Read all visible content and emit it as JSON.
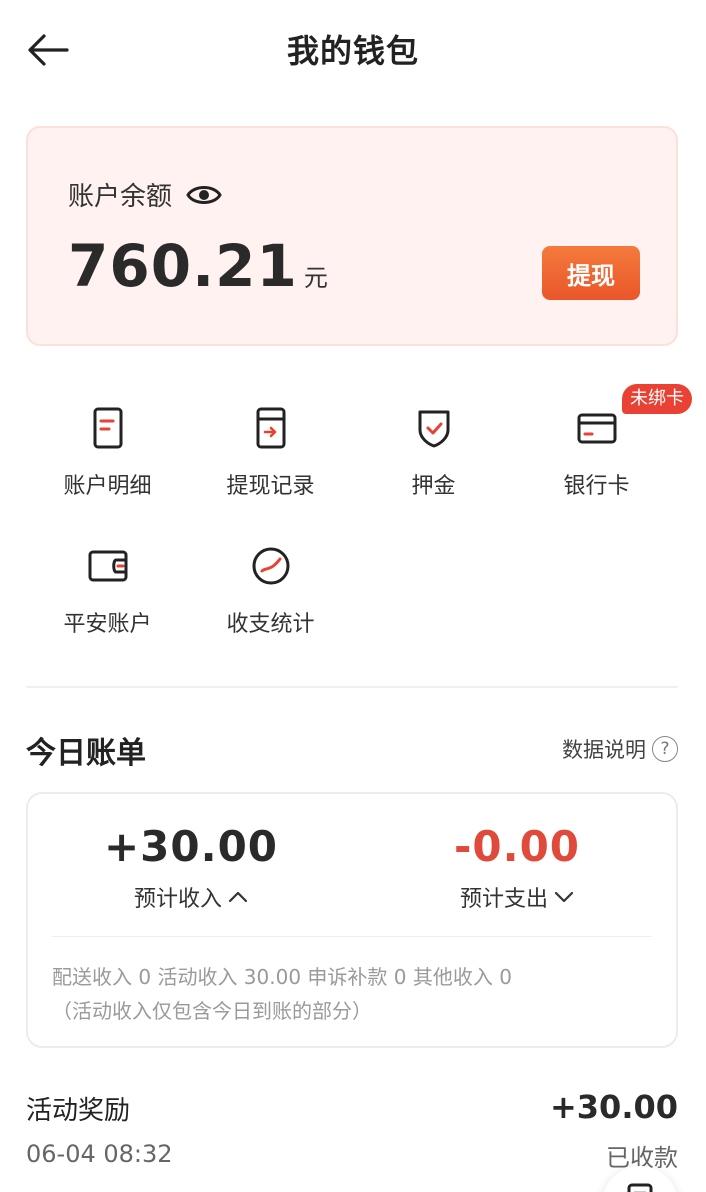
{
  "header": {
    "title": "我的钱包"
  },
  "balance": {
    "label": "账户余额",
    "amount": "760.21",
    "unit": "元",
    "withdraw_label": "提现"
  },
  "grid": {
    "items": [
      {
        "label": "账户明细",
        "icon": "document-icon"
      },
      {
        "label": "提现记录",
        "icon": "withdraw-record-icon"
      },
      {
        "label": "押金",
        "icon": "shield-icon"
      },
      {
        "label": "银行卡",
        "icon": "bank-card-icon",
        "badge": "未绑卡"
      },
      {
        "label": "平安账户",
        "icon": "wallet-icon"
      },
      {
        "label": "收支统计",
        "icon": "stats-icon"
      }
    ]
  },
  "today": {
    "title": "今日账单",
    "data_desc": "数据说明",
    "income": {
      "amount": "+30.00",
      "label": "预计收入"
    },
    "expense": {
      "amount": "-0.00",
      "label": "预计支出"
    },
    "detail_line1": "配送收入 0 活动收入 30.00 申诉补款 0 其他收入 0",
    "detail_line2": "（活动收入仅包含今日到账的部分）"
  },
  "records": [
    {
      "title": "活动奖励",
      "time": "06-04 08:32",
      "amount": "+30.00",
      "status": "已收款"
    }
  ],
  "colors": {
    "accent": "#e94235",
    "card_bg": "#fff2f0",
    "button": "#ef6a33"
  }
}
